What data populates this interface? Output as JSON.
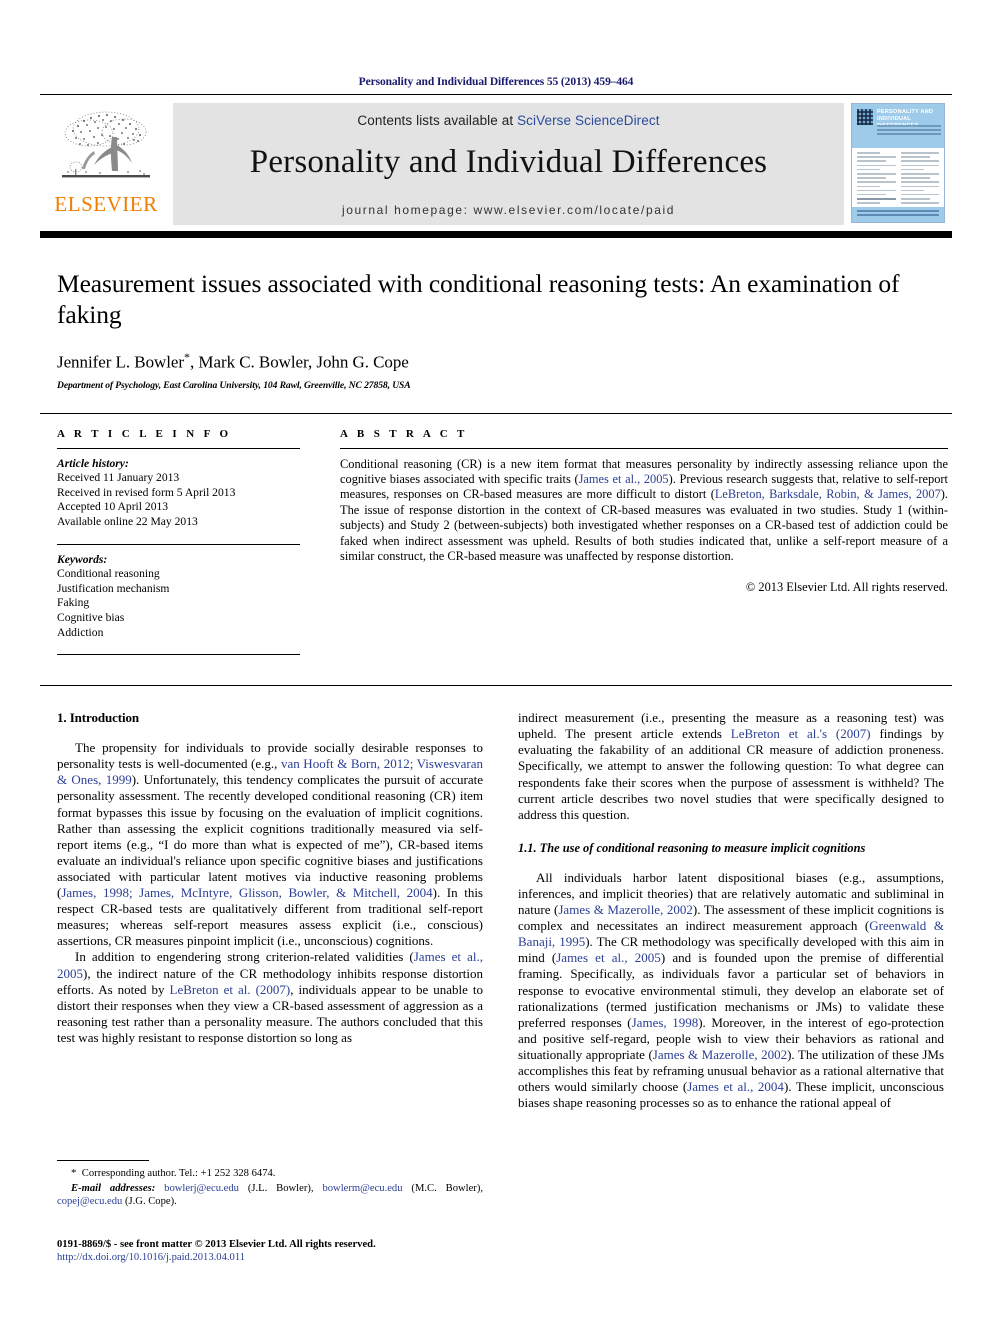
{
  "running_head": "Personality and Individual Differences 55 (2013) 459–464",
  "masthead": {
    "publisher_logo_label": "ELSEVIER",
    "contents_prefix": "Contents lists available at ",
    "contents_link": "SciVerse ScienceDirect",
    "journal_title": "Personality and Individual Differences",
    "homepage_label": "journal homepage: www.elsevier.com/locate/paid",
    "cover": {
      "title": "PERSONALITY AND INDIVIDUAL DIFFERENCES"
    }
  },
  "article": {
    "title": "Measurement issues associated with conditional reasoning tests: An examination of faking",
    "authors": "Jennifer L. Bowler",
    "authors_rest": ", Mark C. Bowler, John G. Cope",
    "corresponding_marker": "*",
    "affiliation": "Department of Psychology, East Carolina University, 104 Rawl, Greenville, NC 27858, USA"
  },
  "article_info": {
    "heading": "A R T I C L E   I N F O",
    "history_label": "Article history:",
    "history": [
      "Received 11 January 2013",
      "Received in revised form 5 April 2013",
      "Accepted 10 April 2013",
      "Available online 22 May 2013"
    ],
    "keywords_label": "Keywords:",
    "keywords": [
      "Conditional reasoning",
      "Justification mechanism",
      "Faking",
      "Cognitive bias",
      "Addiction"
    ]
  },
  "abstract": {
    "heading": "A B S T R A C T",
    "p1_a": "Conditional reasoning (CR) is a new item format that measures personality by indirectly assessing reliance upon the cognitive biases associated with specific traits (",
    "p1_ref1": "James et al., 2005",
    "p1_b": "). Previous research suggests that, relative to self-report measures, responses on CR-based measures are more difficult to distort (",
    "p1_ref2": "LeBreton, Barksdale, Robin, & James, 2007",
    "p1_c": "). The issue of response distortion in the context of CR-based measures was evaluated in two studies. Study 1 (within-subjects) and Study 2 (between-subjects) both investigated whether responses on a CR-based test of addiction could be faked when indirect assessment was upheld. Results of both studies indicated that, unlike a self-report measure of a similar construct, the CR-based measure was unaffected by response distortion.",
    "copyright": "© 2013 Elsevier Ltd. All rights reserved."
  },
  "sections": {
    "intro_heading": "1. Introduction",
    "subsection_heading": "1.1. The use of conditional reasoning to measure implicit cognitions"
  },
  "left_column": {
    "p1_a": "The propensity for individuals to provide socially desirable responses to personality tests is well-documented (e.g., ",
    "p1_ref1": "van Hooft & Born, 2012; Viswesvaran & Ones, 1999",
    "p1_b": "). Unfortunately, this tendency complicates the pursuit of accurate personality assessment. The recently developed conditional reasoning (CR) item format bypasses this issue by focusing on the evaluation of implicit cognitions. Rather than assessing the explicit cognitions traditionally measured via self-report items (e.g., “I do more than what is expected of me”), CR-based items evaluate an individual's reliance upon specific cognitive biases and justifications associated with particular latent motives via inductive reasoning problems (",
    "p1_ref2": "James, 1998; James, McIntyre, Glisson, Bowler, & Mitchell, 2004",
    "p1_c": "). In this respect CR-based tests are qualitatively different from traditional self-report measures; whereas self-report measures assess explicit (i.e., conscious) assertions, CR measures pinpoint implicit (i.e., unconscious) cognitions.",
    "p2_a": "In addition to engendering strong criterion-related validities (",
    "p2_ref1": "James et al., 2005",
    "p2_b": "), the indirect nature of the CR methodology inhibits response distortion efforts. As noted by ",
    "p2_ref2": "LeBreton et al. (2007)",
    "p2_c": ", individuals appear to be unable to distort their responses when they view a CR-based assessment of aggression as a reasoning test rather than a personality measure. The authors concluded that this test was highly resistant to response distortion so long as"
  },
  "right_column": {
    "p1_a": "indirect measurement (i.e., presenting the measure as a reasoning test) was upheld. The present article extends ",
    "p1_ref1": "LeBreton et al.'s (2007)",
    "p1_b": " findings by evaluating the fakability of an additional CR measure of addiction proneness. Specifically, we attempt to answer the following question: To what degree can respondents fake their scores when the purpose of assessment is withheld? The current article describes two novel studies that were specifically designed to address this question.",
    "p2_a": "All individuals harbor latent dispositional biases (e.g., assumptions, inferences, and implicit theories) that are relatively automatic and subliminal in nature (",
    "p2_ref1": "James & Mazerolle, 2002",
    "p2_b": "). The assessment of these implicit cognitions is complex and necessitates an indirect measurement approach (",
    "p2_ref2": "Greenwald & Banaji, 1995",
    "p2_c": "). The CR methodology was specifically developed with this aim in mind (",
    "p2_ref3": "James et al., 2005",
    "p2_d": ") and is founded upon the premise of differential framing. Specifically, as individuals favor a particular set of behaviors in response to evocative environmental stimuli, they develop an elaborate set of rationalizations (termed justification mechanisms or JMs) to validate these preferred responses (",
    "p2_ref4": "James, 1998",
    "p2_e": "). Moreover, in the interest of ego-protection and positive self-regard, people wish to view their behaviors as rational and situationally appropriate (",
    "p2_ref5": "James & Mazerolle, 2002",
    "p2_f": "). The utilization of these JMs accomplishes this feat by reframing unusual behavior as a rational alternative that others would similarly choose (",
    "p2_ref6": "James et al., 2004",
    "p2_g": "). These implicit, unconscious biases shape reasoning processes so as to enhance the rational appeal of"
  },
  "footnotes": {
    "corresponding": "Corresponding author. Tel.: +1 252 328 6474.",
    "email_label": "E-mail addresses:",
    "email1": "bowlerj@ecu.edu",
    "email1_who": " (J.L. Bowler), ",
    "email2": "bowlerm@ecu.edu",
    "email2_who": " (M.C. Bowler), ",
    "email3": "copej@ecu.edu",
    "email3_who": " (J.G. Cope)."
  },
  "footer": {
    "issn_line": "0191-8869/$ - see front matter © 2013 Elsevier Ltd. All rights reserved.",
    "doi": "http://dx.doi.org/10.1016/j.paid.2013.04.011"
  },
  "colors": {
    "link_blue": "#2b3f94",
    "running_head_blue": "#1a1a6e",
    "elsevier_orange": "#F07D00",
    "band_gray": "#e3e3e3",
    "cover_blue": "#9ecbe9"
  }
}
